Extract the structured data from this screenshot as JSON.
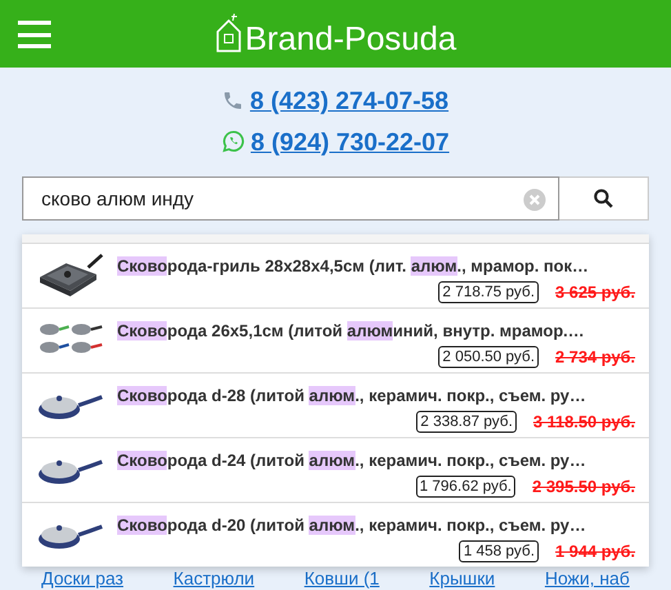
{
  "header": {
    "logo": "Brand-Posuda"
  },
  "phones": [
    {
      "kind": "phone",
      "number": "8 (423) 274-07-58"
    },
    {
      "kind": "whatsapp",
      "number": "8 (924) 730-22-07"
    }
  ],
  "search": {
    "value": "сково алюм инду"
  },
  "suggestions": [
    {
      "title": [
        {
          "text": "Сково",
          "highlight": true
        },
        {
          "text": "рода-гриль 28х28х4,5см (лит. ",
          "highlight": false
        },
        {
          "text": "алюм",
          "highlight": true
        },
        {
          "text": "., мрамор. пок…",
          "highlight": false
        }
      ],
      "price": "2 718.75 руб.",
      "old_price": "3 625 руб.",
      "kind": "square"
    },
    {
      "title": [
        {
          "text": "Сково",
          "highlight": true
        },
        {
          "text": "рода 26х5,1см (литой ",
          "highlight": false
        },
        {
          "text": "алюм",
          "highlight": true
        },
        {
          "text": "иний, внутр. мрамор.…",
          "highlight": false
        }
      ],
      "price": "2 050.50 руб.",
      "old_price": "2 734 руб.",
      "kind": "set"
    },
    {
      "title": [
        {
          "text": "Сково",
          "highlight": true
        },
        {
          "text": "рода d-28 (литой ",
          "highlight": false
        },
        {
          "text": "алюм",
          "highlight": true
        },
        {
          "text": "., керамич. покр., съем. ру…",
          "highlight": false
        }
      ],
      "price": "2 338.87 руб.",
      "old_price": "3 118.50 руб.",
      "kind": "round"
    },
    {
      "title": [
        {
          "text": "Сково",
          "highlight": true
        },
        {
          "text": "рода d-24 (литой ",
          "highlight": false
        },
        {
          "text": "алюм",
          "highlight": true
        },
        {
          "text": "., керамич. покр., съем. ру…",
          "highlight": false
        }
      ],
      "price": "1 796.62 руб.",
      "old_price": "2 395.50 руб.",
      "kind": "round"
    },
    {
      "title": [
        {
          "text": "Сково",
          "highlight": true
        },
        {
          "text": "рода d-20 (литой ",
          "highlight": false
        },
        {
          "text": "алюм",
          "highlight": true
        },
        {
          "text": "., керамич. покр., съем. ру…",
          "highlight": false
        }
      ],
      "price": "1 458 руб.",
      "old_price": "1 944 руб.",
      "kind": "round"
    }
  ],
  "categories": [
    "Доски раз",
    "Кастрюли",
    "Ковши (1",
    "Крышки",
    "Ножи, наб"
  ]
}
